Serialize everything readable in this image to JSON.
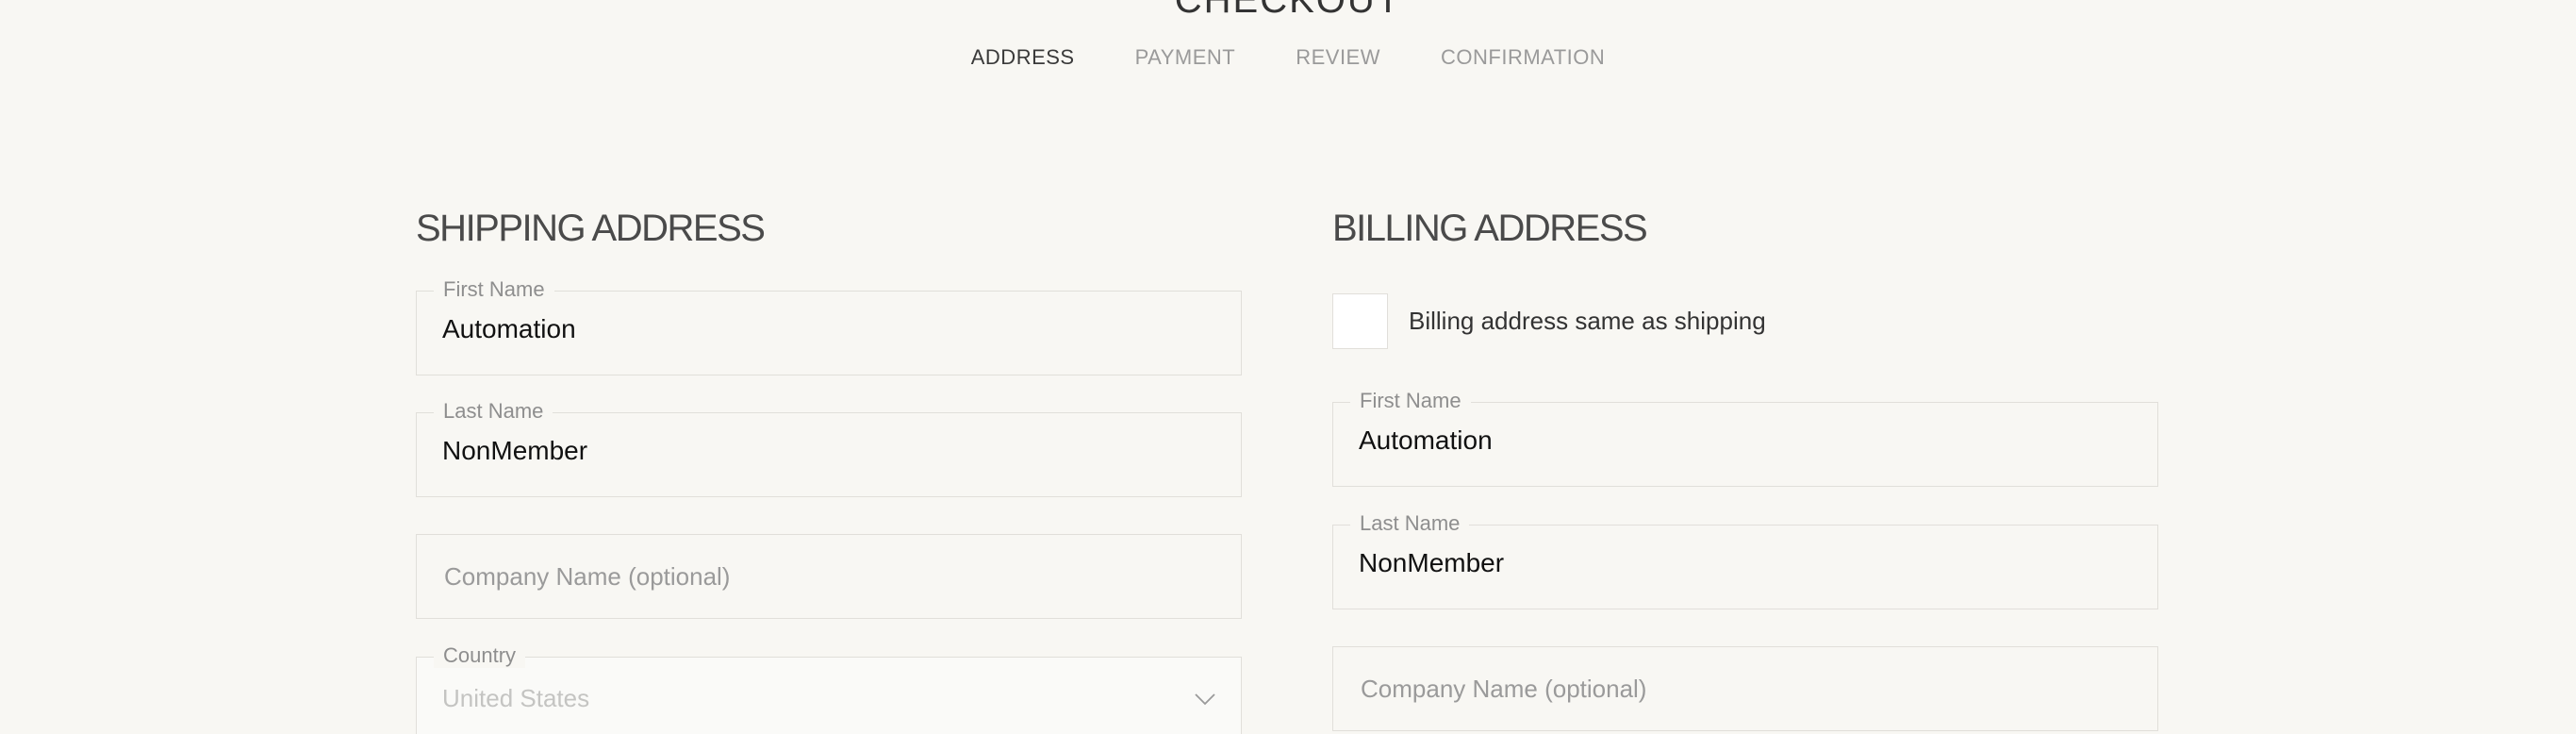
{
  "page": {
    "heading": "CHECKOUT"
  },
  "steps": [
    {
      "label": "ADDRESS",
      "active": true
    },
    {
      "label": "PAYMENT",
      "active": false
    },
    {
      "label": "REVIEW",
      "active": false
    },
    {
      "label": "CONFIRMATION",
      "active": false
    }
  ],
  "shipping": {
    "title": "SHIPPING ADDRESS",
    "first_name": {
      "label": "First Name",
      "value": "Automation"
    },
    "last_name": {
      "label": "Last Name",
      "value": "NonMember"
    },
    "company": {
      "placeholder": "Company Name (optional)"
    },
    "country": {
      "label": "Country",
      "value": "United States",
      "icon": "chevron-down-icon"
    }
  },
  "billing": {
    "title": "BILLING ADDRESS",
    "same_as_shipping": {
      "label": "Billing address same as shipping",
      "checked": false
    },
    "first_name": {
      "label": "First Name",
      "value": "Automation"
    },
    "last_name": {
      "label": "Last Name",
      "value": "NonMember"
    },
    "company": {
      "placeholder": "Company Name (optional)"
    }
  },
  "colors": {
    "background": "#f8f7f3",
    "border": "#e1dfda",
    "muted_text": "#9a9a9a",
    "active_step": "#3a3a3a"
  }
}
